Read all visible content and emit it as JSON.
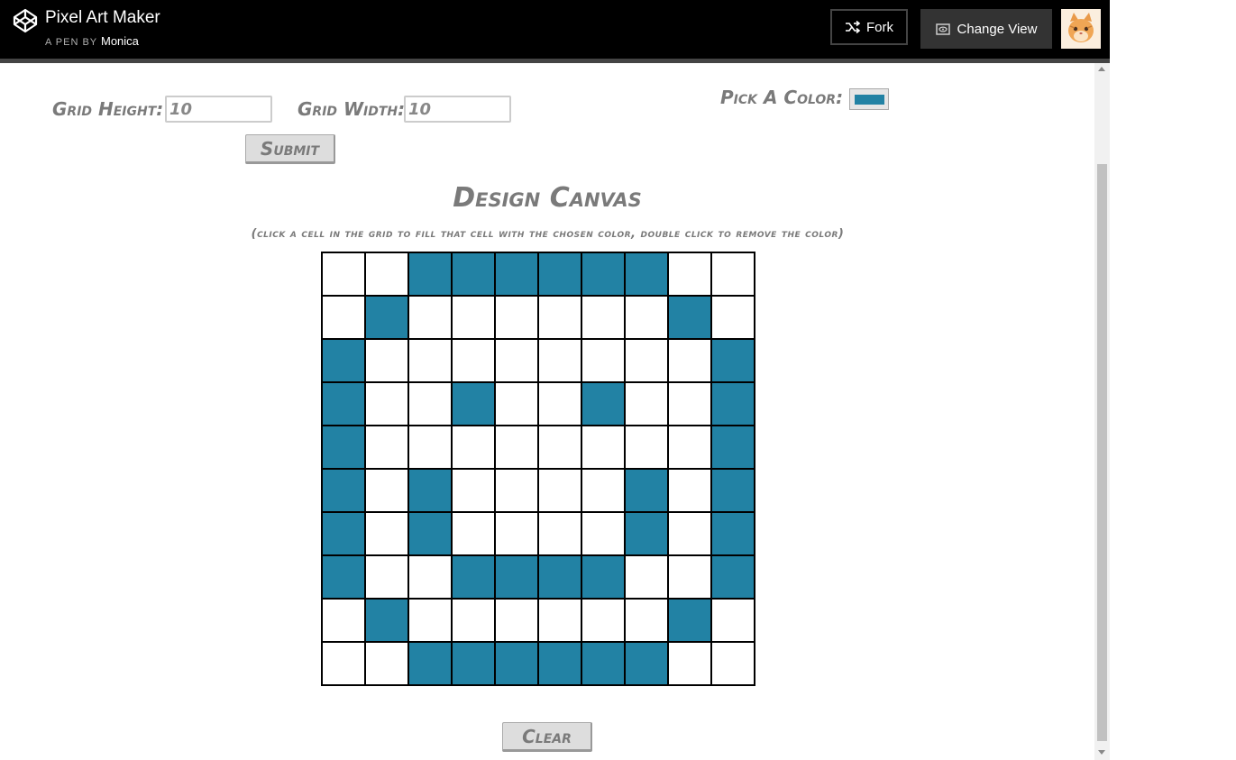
{
  "header": {
    "title": "Pixel Art Maker",
    "byline_prefix": "A PEN BY",
    "author": "Monica",
    "fork_label": "Fork",
    "change_view_label": "Change View"
  },
  "form": {
    "grid_height_label": "Grid Height:",
    "grid_height_value": "10",
    "grid_width_label": "Grid Width:",
    "grid_width_value": "10",
    "submit_label": "Submit",
    "pick_color_label": "Pick A Color:",
    "picked_color": "#2282a4"
  },
  "canvas": {
    "heading": "Design Canvas",
    "instructions": "(click a cell in the grid to fill that cell with the chosen color, double click to remove the color)",
    "grid": [
      [
        0,
        0,
        1,
        1,
        1,
        1,
        1,
        1,
        0,
        0
      ],
      [
        0,
        1,
        0,
        0,
        0,
        0,
        0,
        0,
        1,
        0
      ],
      [
        1,
        0,
        0,
        0,
        0,
        0,
        0,
        0,
        0,
        1
      ],
      [
        1,
        0,
        0,
        1,
        0,
        0,
        1,
        0,
        0,
        1
      ],
      [
        1,
        0,
        0,
        0,
        0,
        0,
        0,
        0,
        0,
        1
      ],
      [
        1,
        0,
        1,
        0,
        0,
        0,
        0,
        1,
        0,
        1
      ],
      [
        1,
        0,
        1,
        0,
        0,
        0,
        0,
        1,
        0,
        1
      ],
      [
        1,
        0,
        0,
        1,
        1,
        1,
        1,
        0,
        0,
        1
      ],
      [
        0,
        1,
        0,
        0,
        0,
        0,
        0,
        0,
        1,
        0
      ],
      [
        0,
        0,
        1,
        1,
        1,
        1,
        1,
        1,
        0,
        0
      ]
    ],
    "clear_label": "Clear"
  },
  "icons": {
    "logo": "codepen-logo-icon",
    "fork": "fork-icon",
    "view": "eye-icon"
  }
}
